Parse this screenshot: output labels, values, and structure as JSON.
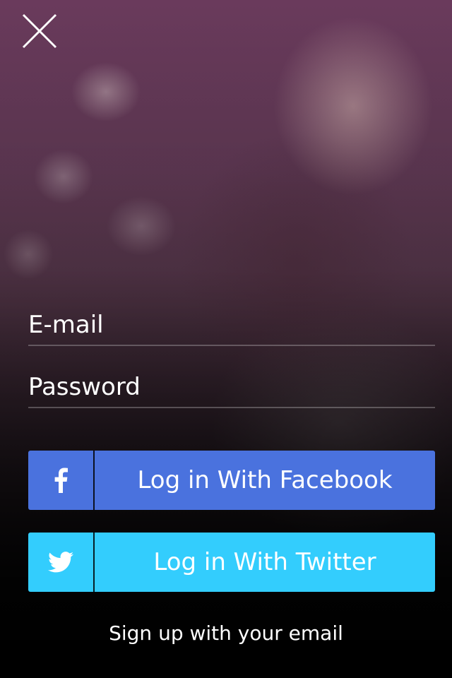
{
  "form": {
    "email_placeholder": "E-mail",
    "password_placeholder": "Password"
  },
  "buttons": {
    "facebook_label": "Log in With Facebook",
    "twitter_label": "Log in With Twitter",
    "signup_label": "Sign up with your email"
  },
  "icons": {
    "close": "close-icon",
    "facebook": "facebook-icon",
    "twitter": "twitter-icon"
  },
  "colors": {
    "facebook": "#4a72de",
    "twitter": "#33cdfd"
  }
}
